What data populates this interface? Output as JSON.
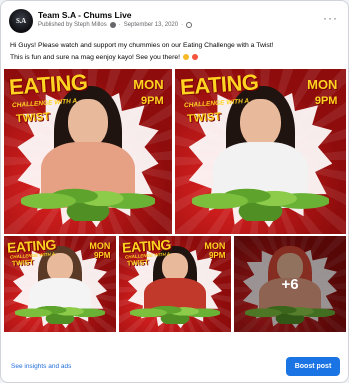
{
  "post": {
    "page_name": "Team S.A - Chums Live",
    "avatar_text": "S.A",
    "published_by": "Published by Steph Millos",
    "date": "September 13, 2020",
    "separator": "·",
    "more_label": "···",
    "text_line1": "Hi Guys! Please watch and support my chummies on our Eating Challenge with a Twist!",
    "text_line2": "This is fun and sure na mag eenjoy kayo! See you there!"
  },
  "poster": {
    "eating": "EATING",
    "challenge": "CHALLENGE WITH A",
    "twist": "TWIST",
    "day": "MON",
    "time": "9PM"
  },
  "gallery": {
    "more_count": "+6"
  },
  "footer": {
    "insights_label": "See insights and ads",
    "boost_label": "Boost post"
  },
  "colors": {
    "accent": "#1b74e4",
    "link": "#216fdb",
    "poster_red": "#b01818",
    "poster_yellow": "#ffd321"
  }
}
